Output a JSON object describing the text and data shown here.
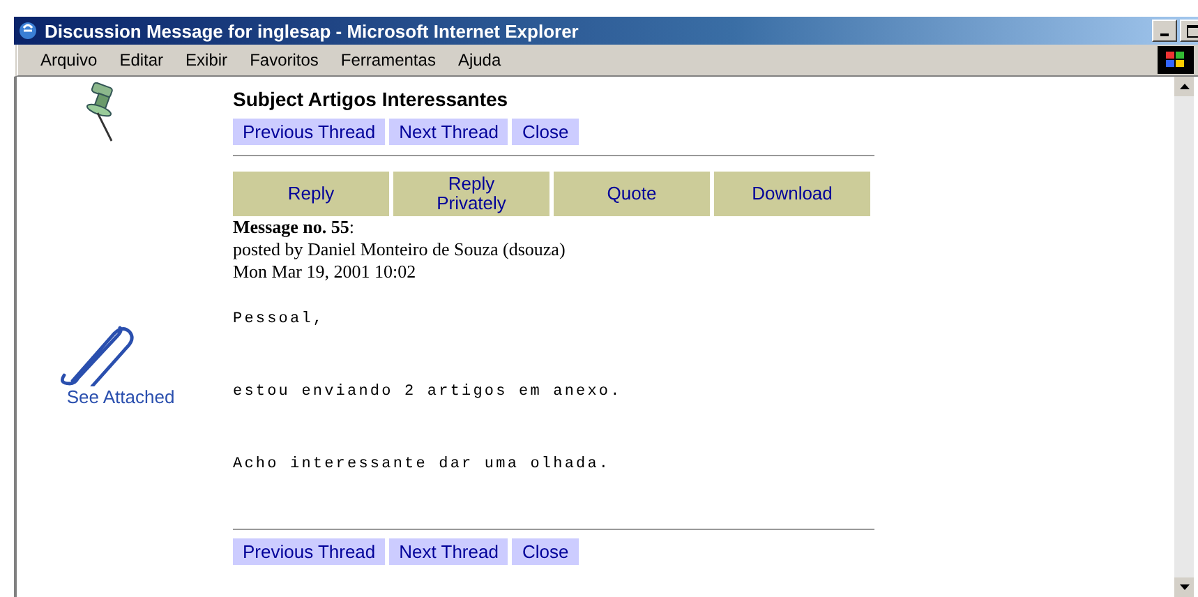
{
  "window": {
    "title": "Discussion Message for inglesap - Microsoft Internet Explorer"
  },
  "menu": [
    "Arquivo",
    "Editar",
    "Exibir",
    "Favoritos",
    "Ferramentas",
    "Ajuda"
  ],
  "subject": "Subject Artigos Interessantes",
  "nav_top": [
    "Previous Thread",
    "Next Thread",
    "Close"
  ],
  "actions": [
    "Reply",
    "Reply Privately",
    "Quote",
    "Download"
  ],
  "message": {
    "number": "**Message no. 55**:",
    "posted_by": "posted by Daniel Monteiro de Souza (dsouza)",
    "date": "Mon Mar 19, 2001 10:02"
  },
  "attachment": {
    "label": "See Attached"
  },
  "body": [
    "Pessoal,",
    "estou enviando 2 artigos em anexo.",
    "Acho interessante dar uma olhada."
  ],
  "nav_bottom": [
    "Previous Thread",
    "Next Thread",
    "Close"
  ]
}
